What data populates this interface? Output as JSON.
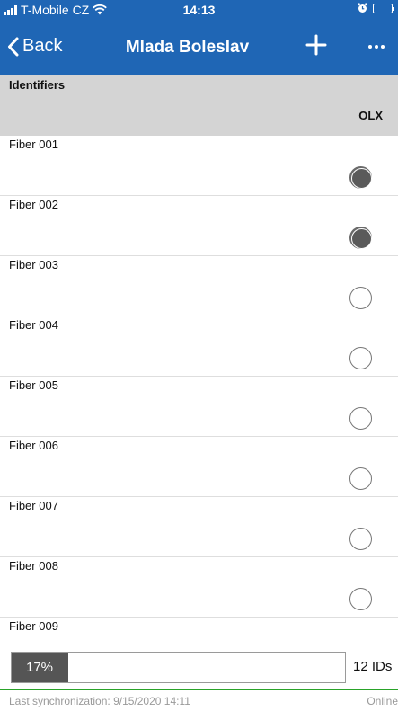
{
  "status_bar": {
    "carrier": "T-Mobile CZ",
    "time": "14:13",
    "signal_bars": 4,
    "battery_level": 1.0,
    "battery_color": "#4cd964"
  },
  "nav": {
    "back_label": "Back",
    "title": "Mlada Boleslav",
    "add_icon": "plus-icon",
    "more_icon": "ellipsis-icon"
  },
  "table": {
    "header_label": "Identifiers",
    "column_label": "OLX",
    "rows": [
      {
        "label": "Fiber 001",
        "checked": true
      },
      {
        "label": "Fiber 002",
        "checked": true
      },
      {
        "label": "Fiber 003",
        "checked": false
      },
      {
        "label": "Fiber 004",
        "checked": false
      },
      {
        "label": "Fiber 005",
        "checked": false
      },
      {
        "label": "Fiber 006",
        "checked": false
      },
      {
        "label": "Fiber 007",
        "checked": false
      },
      {
        "label": "Fiber 008",
        "checked": false
      },
      {
        "label": "Fiber 009",
        "checked": false
      }
    ]
  },
  "progress": {
    "percent_label": "17%",
    "fraction": 0.17,
    "count_label": "12 IDs"
  },
  "footer": {
    "sync_text": "Last synchronization: 9/15/2020 14:11",
    "status_text": "Online",
    "status_color": "#29a329"
  },
  "colors": {
    "accent": "#1f66b5",
    "header_bg": "#d4d4d4",
    "radio_checked": "#5a5a5a"
  }
}
